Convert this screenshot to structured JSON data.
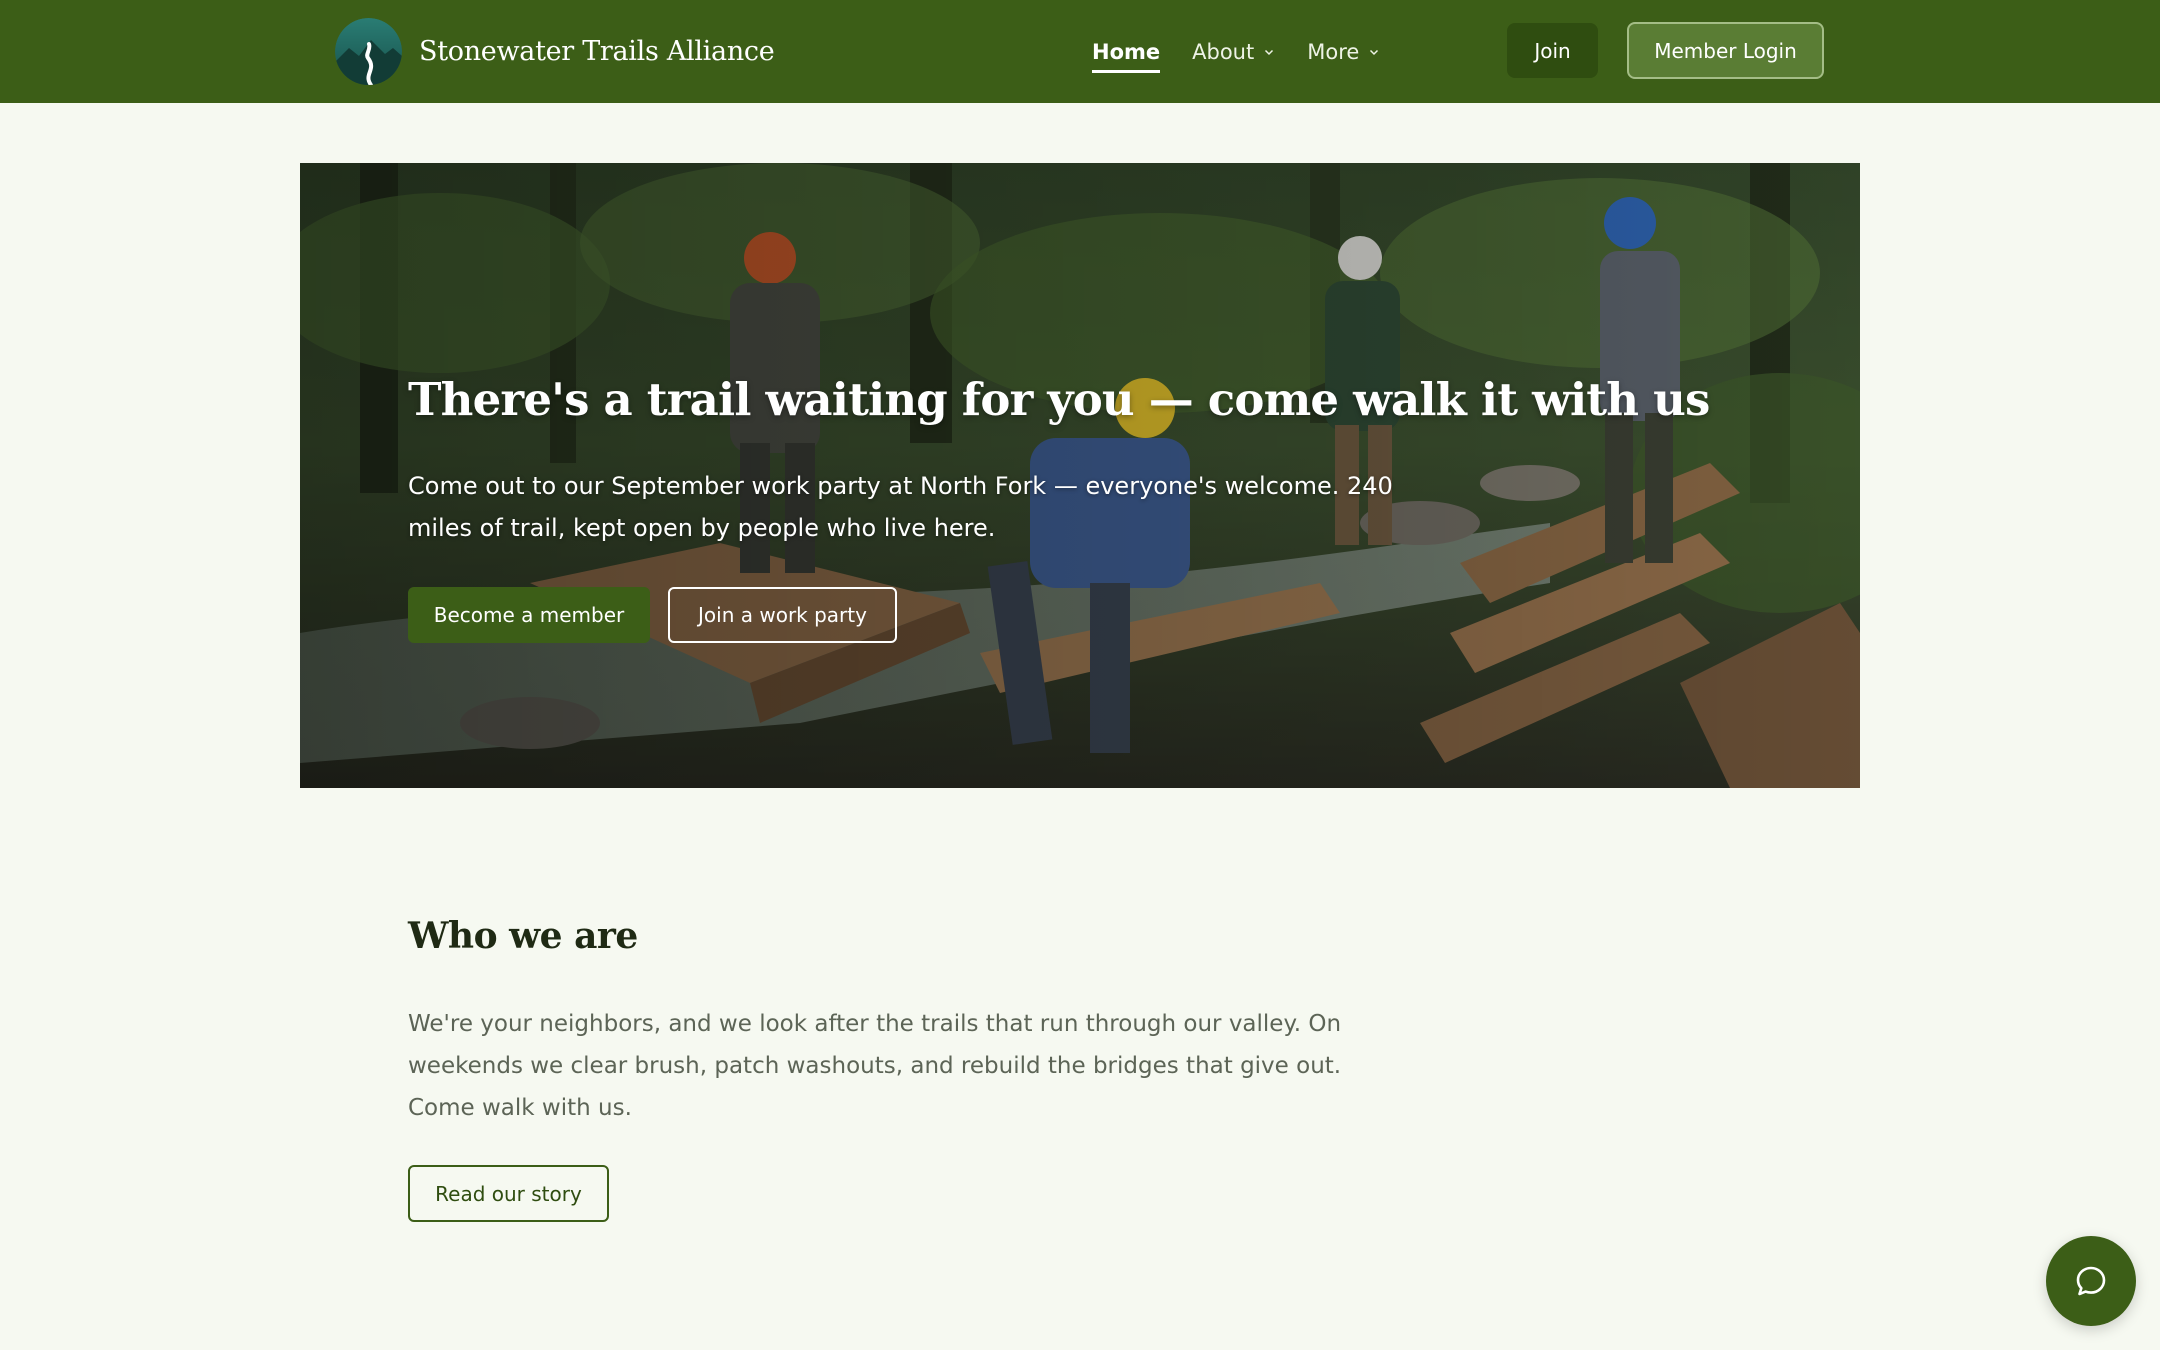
{
  "header": {
    "brand_name": "Stonewater Trails Alliance",
    "nav": [
      {
        "label": "Home",
        "active": true
      },
      {
        "label": "About",
        "dropdown": true
      },
      {
        "label": "More",
        "dropdown": true
      }
    ],
    "join_label": "Join",
    "login_label": "Member Login"
  },
  "hero": {
    "title": "There's a trail waiting for you — come walk it with us",
    "subtitle": "Come out to our September work party at North Fork — everyone's welcome. 240 miles of trail, kept open by people who live here.",
    "primary_cta": "Become a member",
    "secondary_cta": "Join a work party"
  },
  "about": {
    "title": "Who we are",
    "body": "We're your neighbors, and we look after the trails that run through our valley. On weekends we clear brush, patch washouts, and rebuild the bridges that give out. Come walk with us.",
    "cta": "Read our story"
  },
  "icons": {
    "logo": "trail-logo-icon",
    "nav_dropdown": "chevron-down-icon",
    "chat": "chat-bubble-icon"
  },
  "colors": {
    "primary": "#3c5e17",
    "primary_dark": "#2f4d10",
    "background": "#f6f9f1",
    "heading": "#1f2a14",
    "body_text": "#5c6456"
  }
}
